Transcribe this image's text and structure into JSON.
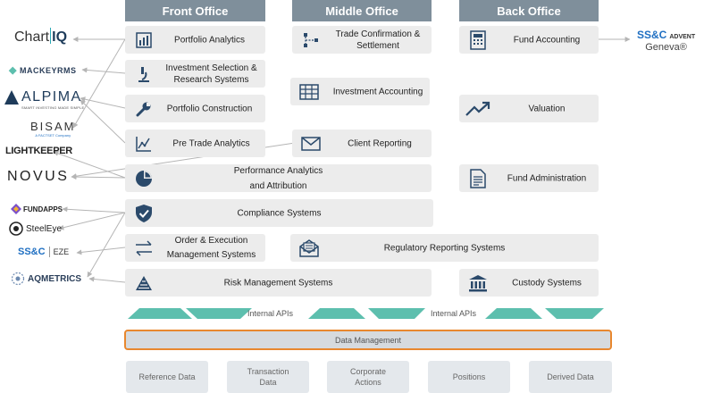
{
  "columns": {
    "front": "Front Office",
    "middle": "Middle Office",
    "back": "Back Office"
  },
  "front": {
    "portfolio_analytics": "Portfolio Analytics",
    "investment_selection_1": "Investment Selection &",
    "investment_selection_2": "Research Systems",
    "portfolio_construction": "Portfolio Construction",
    "pre_trade": "Pre Trade Analytics",
    "performance_1": "Performance Analytics",
    "performance_2": "and Attribution",
    "compliance": "Compliance Systems",
    "order_exec_1": "Order & Execution",
    "order_exec_2": "Management Systems",
    "risk": "Risk Management Systems"
  },
  "middle": {
    "trade_conf_1": "Trade Confirmation &",
    "trade_conf_2": "Settlement",
    "investment_accounting": "Investment Accounting",
    "client_reporting": "Client Reporting",
    "regulatory": "Regulatory Reporting Systems"
  },
  "back": {
    "fund_accounting": "Fund Accounting",
    "valuation": "Valuation",
    "fund_admin": "Fund Administration",
    "custody": "Custody Systems"
  },
  "vendors": {
    "chartiq_a": "Chart",
    "chartiq_b": "IQ",
    "mackey": "MACKEYRMS",
    "alpima": "ALPIMA",
    "alpima_tag": "SMART INVESTING MADE SIMPLE",
    "bisam": "BISAM",
    "bisam_tag": "A FACTSET Company",
    "lightkeeper": "LIGHTKEEPER",
    "novus": "NOVUS",
    "fundapps": "FUNDAPPS",
    "steeleye": "SteelEye",
    "ssc_eze_a": "SS&C",
    "ssc_eze_b": "EZE",
    "aqmetrics": "AQMETRICS",
    "ssc_advent_a": "SS&C",
    "ssc_advent_b": "ADVENT",
    "geneva": "Geneva®"
  },
  "apis": {
    "left": "Internal APIs",
    "right": "Internal APIs"
  },
  "data_management": "Data Management",
  "data_sources": {
    "reference": "Reference Data",
    "transaction_1": "Transaction",
    "transaction_2": "Data",
    "corporate_1": "Corporate",
    "corporate_2": "Actions",
    "positions": "Positions",
    "derived": "Derived Data"
  },
  "colors": {
    "header": "#7f8f9b",
    "icon": "#2b4a6b",
    "box": "#ececec",
    "api_triangle": "#5dbfae",
    "data_mgmt_border": "#e8872e",
    "connector": "#b5b5b5",
    "chartiq_accent": "#2aa9b5",
    "ssc_blue": "#1f6fc2"
  },
  "icons": {
    "portfolio_analytics": "bar-chart-icon",
    "investment_selection": "microscope-icon",
    "portfolio_construction": "wrench-icon",
    "pre_trade": "line-chart-icon",
    "performance": "pie-chart-icon",
    "compliance": "shield-check-icon",
    "order_exec": "arrows-exchange-icon",
    "risk": "pyramid-icon",
    "trade_conf": "flowchart-icon",
    "investment_accounting": "table-icon",
    "client_reporting": "envelope-icon",
    "regulatory": "mail-document-icon",
    "fund_accounting": "calculator-icon",
    "valuation": "trend-up-icon",
    "fund_admin": "document-icon",
    "custody": "bank-icon"
  }
}
